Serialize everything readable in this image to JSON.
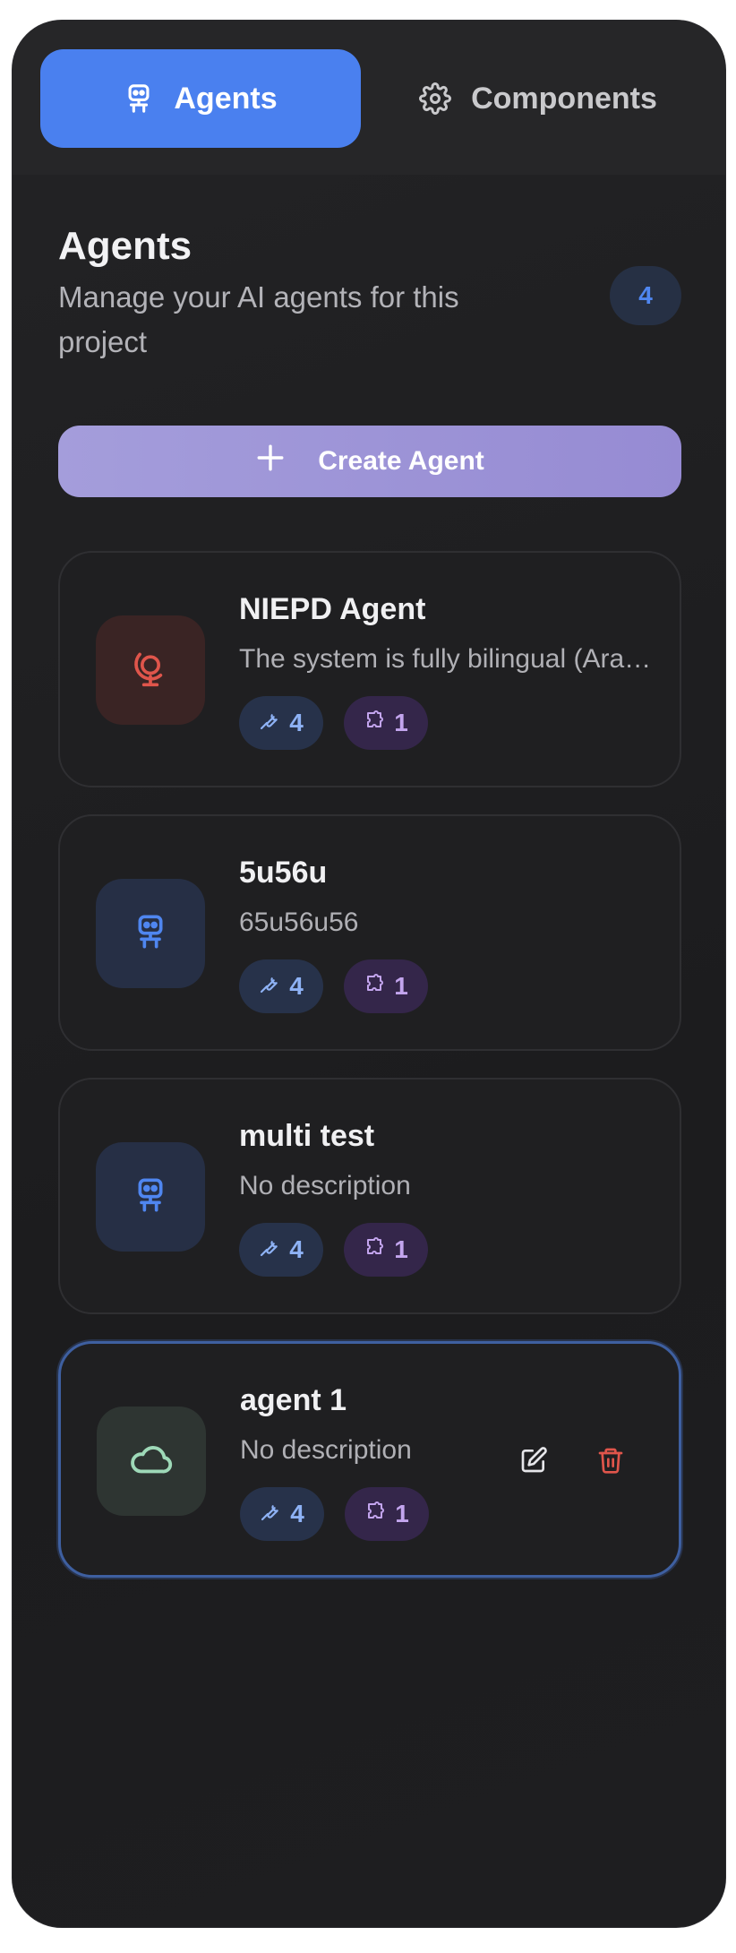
{
  "tabs": [
    {
      "label": "Agents",
      "icon": "robot-icon",
      "active": true
    },
    {
      "label": "Components",
      "icon": "gear-icon",
      "active": false
    }
  ],
  "header": {
    "title": "Agents",
    "subtitle": "Manage your AI agents for this project",
    "count": "4"
  },
  "create_button": {
    "label": "Create Agent",
    "icon": "plus-icon"
  },
  "agents": [
    {
      "name": "NIEPD Agent",
      "description": "The system is fully bilingual (Arabic and English)",
      "icon": "globe-stand-icon",
      "icon_color": "#e0554b",
      "tools_count": "4",
      "components_count": "1"
    },
    {
      "name": "5u56u",
      "description": "65u56u56",
      "icon": "robot-icon",
      "icon_color": "#4f86f0",
      "tools_count": "4",
      "components_count": "1"
    },
    {
      "name": "multi test",
      "description": "No description",
      "icon": "robot-icon",
      "icon_color": "#4f86f0",
      "tools_count": "4",
      "components_count": "1"
    },
    {
      "name": "agent 1",
      "description": "No description",
      "icon": "cloud-icon",
      "icon_color": "#9ed9b8",
      "tools_count": "4",
      "components_count": "1",
      "selected": true
    }
  ],
  "colors": {
    "accent": "#4a80ef",
    "create_button": "#a49ddb",
    "delete": "#e0554b"
  }
}
